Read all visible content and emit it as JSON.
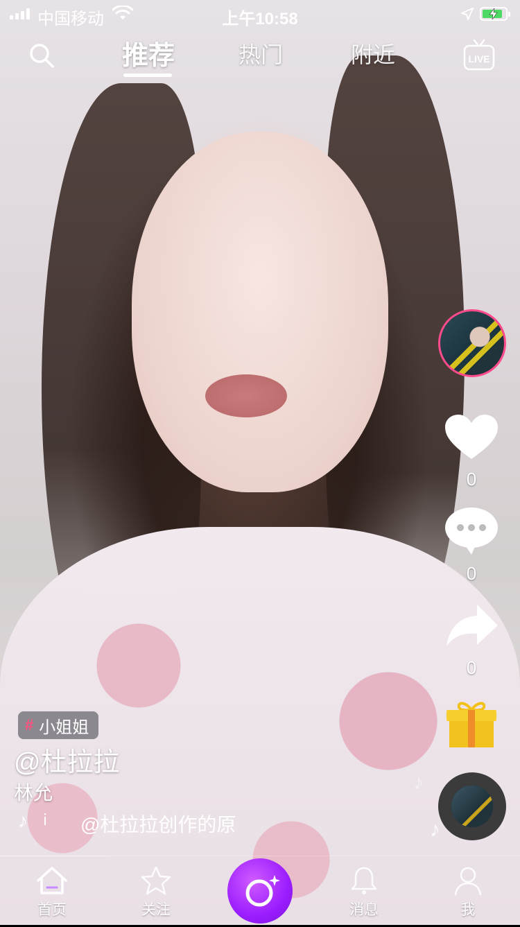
{
  "status_bar": {
    "carrier": "中国移动",
    "time": "上午10:58"
  },
  "top_nav": {
    "tabs": [
      {
        "label": "推荐",
        "active": true
      },
      {
        "label": "热门",
        "active": false
      },
      {
        "label": "附近",
        "active": false
      }
    ],
    "live_label": "LIVE"
  },
  "actions": {
    "like_count": "0",
    "comment_count": "0",
    "share_count": "0"
  },
  "caption": {
    "tag": "小姐姐",
    "author": "@杜拉拉",
    "description": "林允",
    "music_dot": "ⅰ",
    "music": "@杜拉拉创作的原"
  },
  "bottom_nav": {
    "home": "首页",
    "follow": "关注",
    "messages": "消息",
    "me": "我"
  },
  "colors": {
    "accent_pink": "#ff4b8b",
    "create_purple": "#9b1dff",
    "battery_green": "#4cd964"
  },
  "icons": [
    "search-icon",
    "live-icon",
    "heart-icon",
    "comment-icon",
    "share-icon",
    "gift-icon",
    "music-note-icon",
    "home-icon",
    "star-icon",
    "bell-icon",
    "person-icon",
    "create-icon"
  ]
}
